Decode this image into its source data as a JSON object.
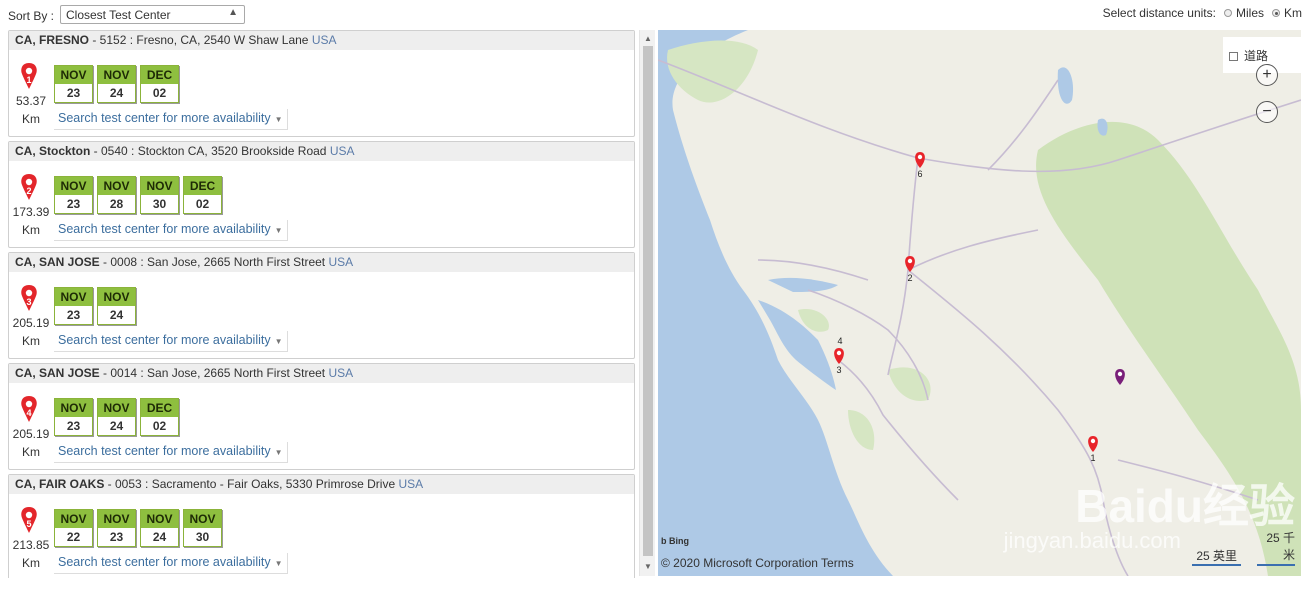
{
  "sort": {
    "label": "Sort By :",
    "selected": "Closest Test Center"
  },
  "units": {
    "label": "Select distance units:",
    "miles": "Miles",
    "km": "Km",
    "selected": "Km"
  },
  "centers": [
    {
      "num": "1",
      "city": "CA, FRESNO",
      "addr": " - 5152 : Fresno, CA, 2540 W Shaw Lane ",
      "country": "USA",
      "distance": "53.37",
      "unit": "Km",
      "dates": [
        {
          "mon": "NOV",
          "day": "23"
        },
        {
          "mon": "NOV",
          "day": "24"
        },
        {
          "mon": "DEC",
          "day": "02"
        }
      ]
    },
    {
      "num": "2",
      "city": "CA, Stockton",
      "addr": " - 0540 : Stockton CA, 3520 Brookside Road ",
      "country": "USA",
      "distance": "173.39",
      "unit": "Km",
      "dates": [
        {
          "mon": "NOV",
          "day": "23"
        },
        {
          "mon": "NOV",
          "day": "28"
        },
        {
          "mon": "NOV",
          "day": "30"
        },
        {
          "mon": "DEC",
          "day": "02"
        }
      ]
    },
    {
      "num": "3",
      "city": "CA, SAN JOSE",
      "addr": " - 0008 : San Jose, 2665 North First Street ",
      "country": "USA",
      "distance": "205.19",
      "unit": "Km",
      "dates": [
        {
          "mon": "NOV",
          "day": "23"
        },
        {
          "mon": "NOV",
          "day": "24"
        }
      ]
    },
    {
      "num": "4",
      "city": "CA, SAN JOSE",
      "addr": " - 0014 : San Jose, 2665 North First Street ",
      "country": "USA",
      "distance": "205.19",
      "unit": "Km",
      "dates": [
        {
          "mon": "NOV",
          "day": "23"
        },
        {
          "mon": "NOV",
          "day": "24"
        },
        {
          "mon": "DEC",
          "day": "02"
        }
      ]
    },
    {
      "num": "5",
      "city": "CA, FAIR OAKS",
      "addr": " - 0053 : Sacramento - Fair Oaks, 5330 Primrose Drive ",
      "country": "USA",
      "distance": "213.85",
      "unit": "Km",
      "dates": [
        {
          "mon": "NOV",
          "day": "22"
        },
        {
          "mon": "NOV",
          "day": "23"
        },
        {
          "mon": "NOV",
          "day": "24"
        },
        {
          "mon": "NOV",
          "day": "30"
        }
      ]
    }
  ],
  "more_link": "Search test center for more availability",
  "map": {
    "layer_label": "道路",
    "zoom_in": "+",
    "zoom_out": "−",
    "bing": "b Bing",
    "copyright": "© 2020 Microsoft Corporation Terms",
    "scale_imperial": "25 英里",
    "scale_metric": "25 千米",
    "markers": [
      {
        "label": "6"
      },
      {
        "label": "2"
      },
      {
        "label": "4"
      },
      {
        "label": "3"
      },
      {
        "label": "1"
      }
    ],
    "watermark": "Baidu经验",
    "watermark_url": "jingyan.baidu.com",
    "pin_color": "#e8242a",
    "user_pin_color": "#7a1f7a"
  }
}
